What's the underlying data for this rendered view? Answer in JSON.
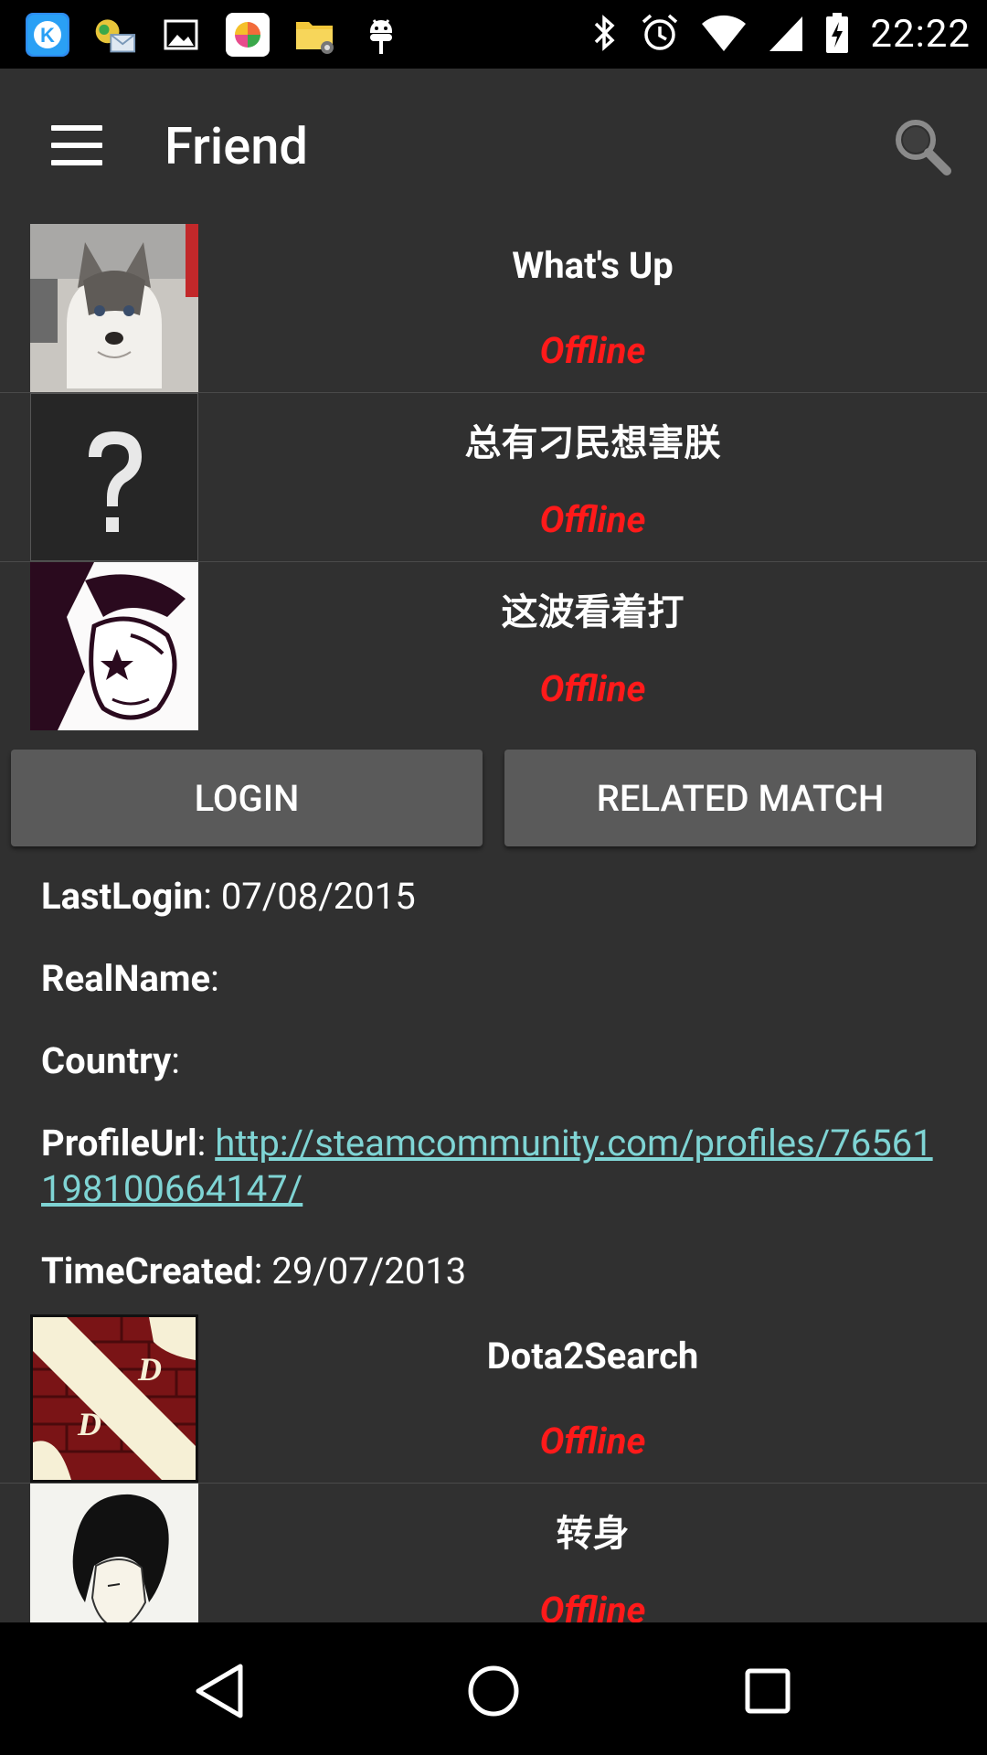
{
  "status_bar": {
    "time": "22:22",
    "notification_icons": [
      "kakao-icon",
      "email-icon",
      "gallery-icon",
      "color-app-icon",
      "file-manager-icon",
      "android-debug-icon"
    ],
    "system_icons": [
      "bluetooth-icon",
      "alarm-icon",
      "wifi-icon",
      "cell-signal-icon",
      "battery-charging-icon"
    ]
  },
  "app_bar": {
    "title": "Friend"
  },
  "friends_top": [
    {
      "name": "What's Up",
      "status": "Offline",
      "avatar": "husky-avatar"
    },
    {
      "name": "总有刁民想害朕",
      "status": "Offline",
      "avatar": "unknown-avatar"
    },
    {
      "name": "这波看着打",
      "status": "Offline",
      "avatar": "manga-avatar"
    }
  ],
  "buttons": {
    "login": "LOGIN",
    "related_match": "RELATED MATCH"
  },
  "profile": {
    "last_login_label": "LastLogin",
    "last_login_value": "07/08/2015",
    "real_name_label": "RealName",
    "real_name_value": "",
    "country_label": "Country",
    "country_value": "",
    "profile_url_label": "ProfileUrl",
    "profile_url_value": "http://steamcommunity.com/profiles/76561198100664147/",
    "time_created_label": "TimeCreated",
    "time_created_value": "29/07/2013"
  },
  "friends_bottom": [
    {
      "name": "Dota2Search",
      "status": "Offline",
      "avatar": "dota-avatar"
    },
    {
      "name": "转身",
      "status": "Offline",
      "avatar": "sketch-avatar"
    }
  ],
  "colors": {
    "background": "#303030",
    "status_offline": "#ff1a1a",
    "link": "#7fd4d4",
    "button": "#5a5a5a"
  }
}
